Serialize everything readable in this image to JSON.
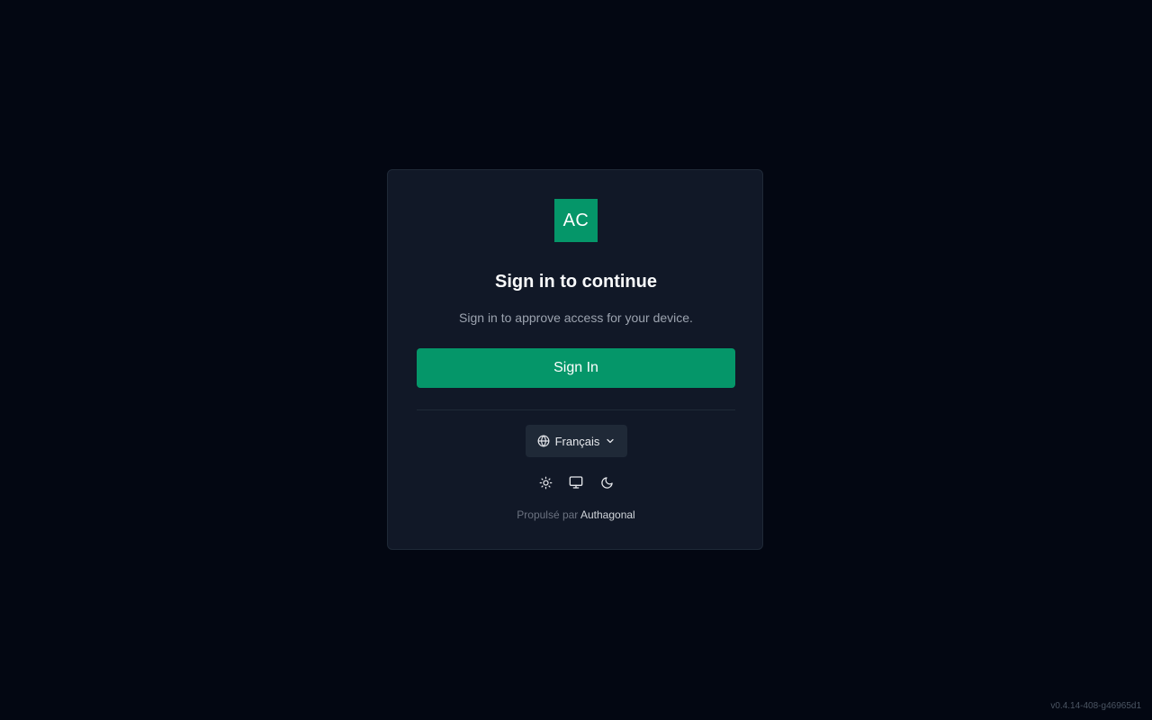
{
  "card": {
    "logo_text": "AC",
    "title": "Sign in to continue",
    "subtitle": "Sign in to approve access for your device.",
    "sign_in_label": "Sign In"
  },
  "language": {
    "selected": "Français",
    "icon": "globe-icon",
    "dropdown_icon": "chevron-down-icon"
  },
  "theme_options": [
    {
      "icon": "sun-icon"
    },
    {
      "icon": "monitor-icon"
    },
    {
      "icon": "moon-icon"
    }
  ],
  "footer": {
    "powered_prefix": "Propulsé par",
    "powered_brand": "Authagonal"
  },
  "version": "v0.4.14-408-g46965d1",
  "colors": {
    "background": "#030712",
    "card": "#111827",
    "accent": "#059669"
  }
}
